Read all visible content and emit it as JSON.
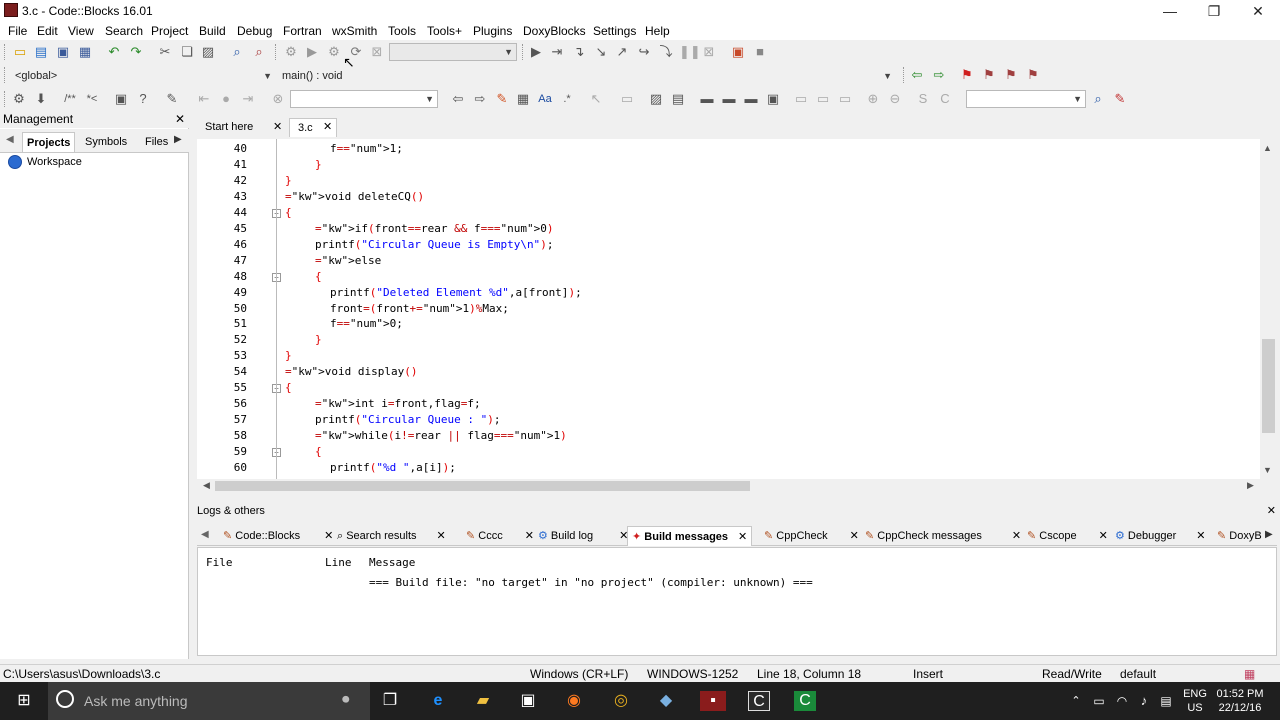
{
  "window": {
    "title": "3.c - Code::Blocks 16.01",
    "controls": {
      "minimize": "—",
      "restore": "❐",
      "close": "✕"
    }
  },
  "menu": [
    "File",
    "Edit",
    "View",
    "Search",
    "Project",
    "Build",
    "Debug",
    "Fortran",
    "wxSmith",
    "Tools",
    "Tools+",
    "Plugins",
    "DoxyBlocks",
    "Settings",
    "Help"
  ],
  "code_toolbar": {
    "scope": "<global>",
    "function": "main() : void"
  },
  "management": {
    "title": "Management",
    "tabs": [
      "Projects",
      "Symbols",
      "Files"
    ],
    "workspace_label": "Workspace"
  },
  "editor_tabs": [
    "Start here",
    "3.c"
  ],
  "code_lines": [
    {
      "n": "40",
      "indent": 3,
      "text": "f=1;"
    },
    {
      "n": "41",
      "indent": 2,
      "text": "}"
    },
    {
      "n": "42",
      "indent": 0,
      "text": "}"
    },
    {
      "n": "43",
      "indent": 0,
      "text": "void deleteCQ()"
    },
    {
      "n": "44",
      "indent": 0,
      "text": "{"
    },
    {
      "n": "45",
      "indent": 2,
      "text": "if(front==rear && f==0)"
    },
    {
      "n": "46",
      "indent": 2,
      "text": "printf(\"Circular Queue is Empty\\n\");"
    },
    {
      "n": "47",
      "indent": 2,
      "text": "else"
    },
    {
      "n": "48",
      "indent": 2,
      "text": "{"
    },
    {
      "n": "49",
      "indent": 3,
      "text": "printf(\"Deleted Element %d\",a[front]);"
    },
    {
      "n": "50",
      "indent": 3,
      "text": "front=(front+1)%Max;"
    },
    {
      "n": "51",
      "indent": 3,
      "text": "f=0;"
    },
    {
      "n": "52",
      "indent": 2,
      "text": "}"
    },
    {
      "n": "53",
      "indent": 0,
      "text": "}"
    },
    {
      "n": "54",
      "indent": 0,
      "text": "void display()"
    },
    {
      "n": "55",
      "indent": 0,
      "text": "{"
    },
    {
      "n": "56",
      "indent": 2,
      "text": "int i=front,flag=f;"
    },
    {
      "n": "57",
      "indent": 2,
      "text": "printf(\"Circular Queue : \");"
    },
    {
      "n": "58",
      "indent": 2,
      "text": "while(i!=rear || flag==1)"
    },
    {
      "n": "59",
      "indent": 2,
      "text": "{"
    },
    {
      "n": "60",
      "indent": 3,
      "text": "printf(\"%d \",a[i]);"
    }
  ],
  "logs": {
    "title": "Logs & others",
    "tabs": [
      "Code::Blocks",
      "Search results",
      "Cccc",
      "Build log",
      "Build messages",
      "CppCheck",
      "CppCheck messages",
      "Cscope",
      "Debugger",
      "DoxyB"
    ],
    "active_tab": "Build messages",
    "columns": [
      "File",
      "Line",
      "Message"
    ],
    "message": "=== Build file: \"no target\" in \"no project\" (compiler: unknown) ==="
  },
  "status": {
    "path": "C:\\Users\\asus\\Downloads\\3.c",
    "eol": "Windows (CR+LF)",
    "encoding": "WINDOWS-1252",
    "position": "Line 18, Column 18",
    "mode": "Insert",
    "access": "Read/Write",
    "profile": "default"
  },
  "taskbar": {
    "search_placeholder": "Ask me anything",
    "lang_line1": "ENG",
    "lang_line2": "US",
    "time": "01:52 PM",
    "date": "22/12/16"
  }
}
